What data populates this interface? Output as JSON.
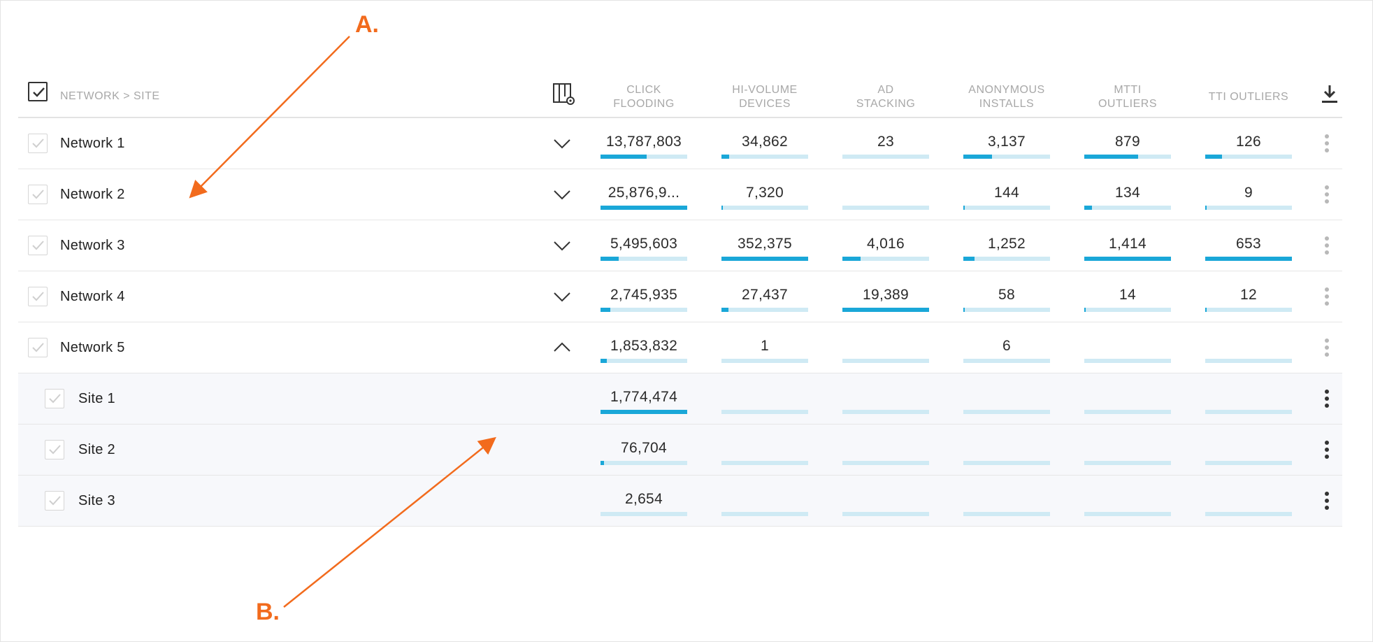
{
  "header": {
    "name_label": "NETWORK > SITE",
    "columns": [
      {
        "key": "click_flooding",
        "label": "CLICK\nFLOODING"
      },
      {
        "key": "hi_volume",
        "label": "HI-VOLUME\nDEVICES"
      },
      {
        "key": "ad_stacking",
        "label": "AD\nSTACKING"
      },
      {
        "key": "anon_installs",
        "label": "ANONYMOUS\nINSTALLS"
      },
      {
        "key": "mtti",
        "label": "MTTI\nOUTLIERS"
      },
      {
        "key": "tti",
        "label": "TTI OUTLIERS"
      }
    ]
  },
  "rows": [
    {
      "type": "network",
      "name": "Network 1",
      "expanded": false,
      "cells": [
        {
          "value": "13,787,803",
          "fill": 0.53
        },
        {
          "value": "34,862",
          "fill": 0.09
        },
        {
          "value": "23",
          "fill": 0
        },
        {
          "value": "3,137",
          "fill": 0.33
        },
        {
          "value": "879",
          "fill": 0.62
        },
        {
          "value": "126",
          "fill": 0.19
        }
      ]
    },
    {
      "type": "network",
      "name": "Network 2",
      "expanded": false,
      "cells": [
        {
          "value": "25,876,9...",
          "fill": 1.0
        },
        {
          "value": "7,320",
          "fill": 0.02
        },
        {
          "value": "",
          "fill": 0
        },
        {
          "value": "144",
          "fill": 0.01
        },
        {
          "value": "134",
          "fill": 0.09
        },
        {
          "value": "9",
          "fill": 0.01
        }
      ]
    },
    {
      "type": "network",
      "name": "Network 3",
      "expanded": false,
      "cells": [
        {
          "value": "5,495,603",
          "fill": 0.21
        },
        {
          "value": "352,375",
          "fill": 1.0
        },
        {
          "value": "4,016",
          "fill": 0.21
        },
        {
          "value": "1,252",
          "fill": 0.13
        },
        {
          "value": "1,414",
          "fill": 1.0
        },
        {
          "value": "653",
          "fill": 1.0
        }
      ]
    },
    {
      "type": "network",
      "name": "Network 4",
      "expanded": false,
      "cells": [
        {
          "value": "2,745,935",
          "fill": 0.11
        },
        {
          "value": "27,437",
          "fill": 0.08
        },
        {
          "value": "19,389",
          "fill": 1.0
        },
        {
          "value": "58",
          "fill": 0.01
        },
        {
          "value": "14",
          "fill": 0.01
        },
        {
          "value": "12",
          "fill": 0.01
        }
      ]
    },
    {
      "type": "network",
      "name": "Network 5",
      "expanded": true,
      "cells": [
        {
          "value": "1,853,832",
          "fill": 0.07
        },
        {
          "value": "1",
          "fill": 0
        },
        {
          "value": "",
          "fill": 0
        },
        {
          "value": "6",
          "fill": 0
        },
        {
          "value": "",
          "fill": 0
        },
        {
          "value": "",
          "fill": 0
        }
      ]
    },
    {
      "type": "site",
      "name": "Site 1",
      "cells": [
        {
          "value": "1,774,474",
          "fill": 1.0
        },
        {
          "value": "",
          "fill": 0
        },
        {
          "value": "",
          "fill": 0
        },
        {
          "value": "",
          "fill": 0
        },
        {
          "value": "",
          "fill": 0
        },
        {
          "value": "",
          "fill": 0
        }
      ]
    },
    {
      "type": "site",
      "name": "Site 2",
      "cells": [
        {
          "value": "76,704",
          "fill": 0.04
        },
        {
          "value": "",
          "fill": 0
        },
        {
          "value": "",
          "fill": 0
        },
        {
          "value": "",
          "fill": 0
        },
        {
          "value": "",
          "fill": 0
        },
        {
          "value": "",
          "fill": 0
        }
      ]
    },
    {
      "type": "site",
      "name": "Site 3",
      "cells": [
        {
          "value": "2,654",
          "fill": 0
        },
        {
          "value": "",
          "fill": 0
        },
        {
          "value": "",
          "fill": 0
        },
        {
          "value": "",
          "fill": 0
        },
        {
          "value": "",
          "fill": 0
        },
        {
          "value": "",
          "fill": 0
        }
      ]
    }
  ],
  "annotations": {
    "a": "A.",
    "b": "B."
  },
  "colors": {
    "accent": "#1aa7d8",
    "track": "#cfeaf4",
    "annotation": "#f26b1d"
  },
  "icons": [
    "check-icon",
    "column-settings-icon",
    "download-icon",
    "chevron-down-icon",
    "chevron-up-icon",
    "more-vertical-icon"
  ]
}
